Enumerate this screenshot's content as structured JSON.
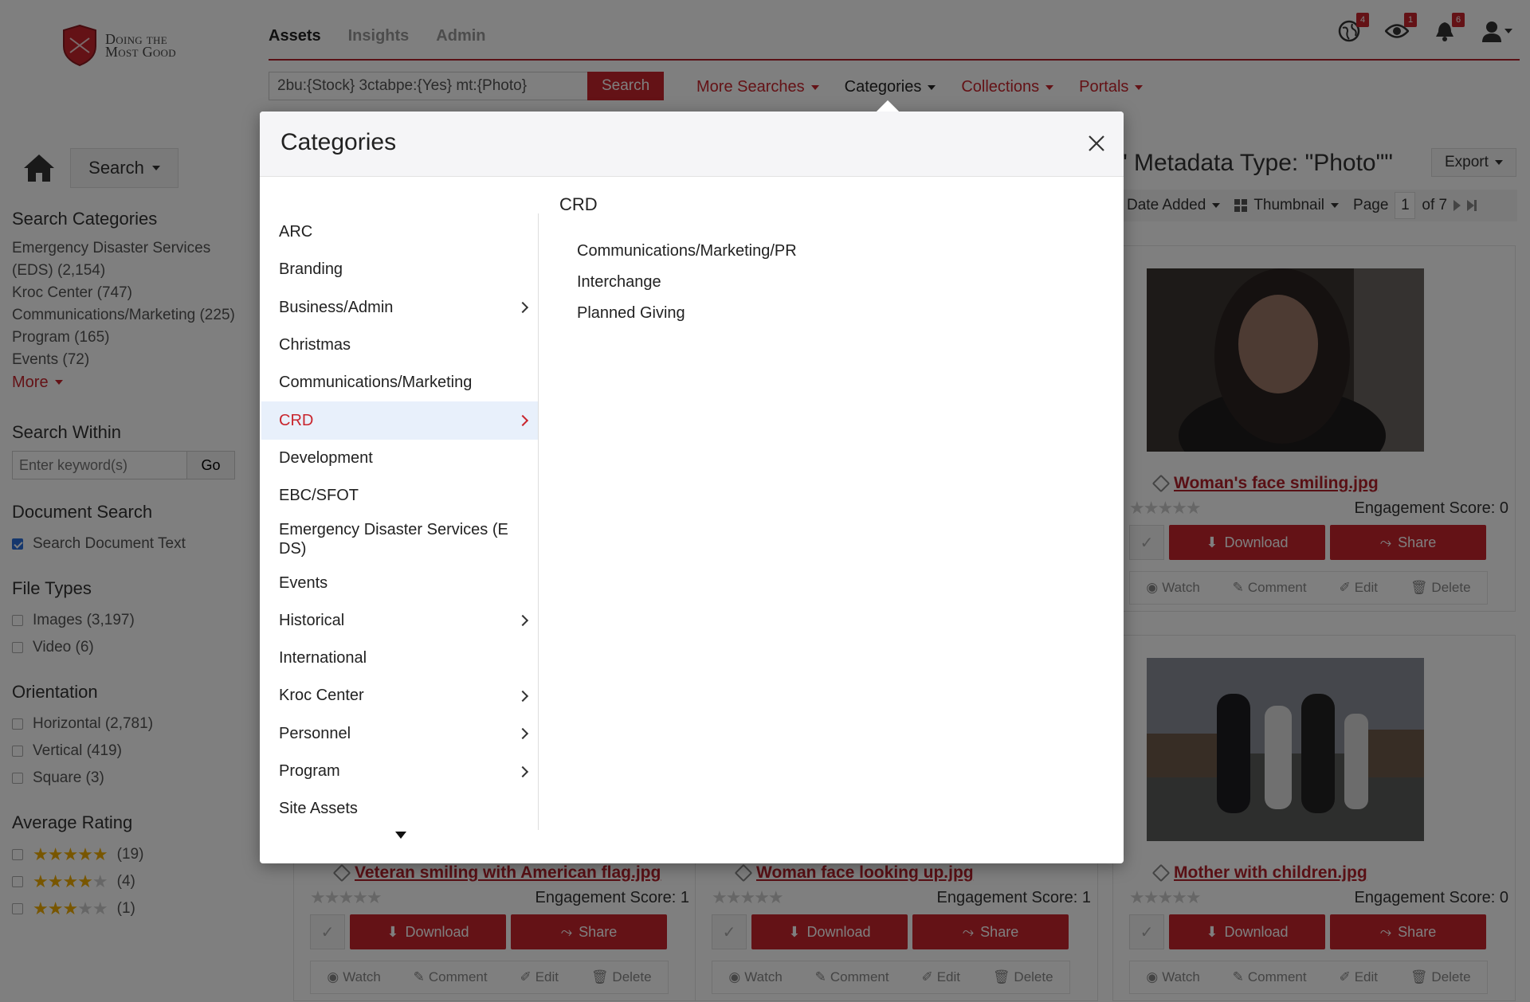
{
  "header": {
    "logo_text_line1": "Doing the",
    "logo_text_line2": "Most Good",
    "tabs": [
      {
        "label": "Assets",
        "active": true
      },
      {
        "label": "Insights",
        "active": false
      },
      {
        "label": "Admin",
        "active": false
      }
    ],
    "icons": [
      {
        "name": "globe-icon",
        "badge": "4"
      },
      {
        "name": "eye-icon",
        "badge": "1"
      },
      {
        "name": "bell-icon",
        "badge": "6"
      },
      {
        "name": "user-icon",
        "badge": ""
      }
    ]
  },
  "search": {
    "query": "2bu:{Stock} 3ctabpe:{Yes} mt:{Photo}",
    "button_label": "Search"
  },
  "nav": {
    "menus": [
      "More Searches",
      "Categories",
      "Collections",
      "Portals"
    ],
    "active_menu": "Categories"
  },
  "sidebar": {
    "search_button_label": "Search",
    "search_categories": {
      "heading": "Search Categories",
      "items": [
        "Emergency Disaster Services (EDS) (2,154)",
        "Kroc Center (747)",
        "Communications/Marketing (225)",
        "Program (165)",
        "Events (72)"
      ],
      "more_label": "More"
    },
    "search_within": {
      "heading": "Search Within",
      "placeholder": "Enter keyword(s)",
      "go_label": "Go"
    },
    "document_search": {
      "heading": "Document Search",
      "option": "Search Document Text",
      "checked": true
    },
    "file_types": {
      "heading": "File Types",
      "options": [
        "Images (3,197)",
        "Video (6)"
      ]
    },
    "orientation": {
      "heading": "Orientation",
      "options": [
        "Horizontal (2,781)",
        "Vertical (419)",
        "Square (3)"
      ]
    },
    "average_rating": {
      "heading": "Average Rating",
      "options": [
        {
          "stars": 5,
          "count": "(19)"
        },
        {
          "stars": 4,
          "count": "(4)"
        },
        {
          "stars": 3,
          "count": "(1)"
        }
      ]
    }
  },
  "results": {
    "title_fragment": "\" Metadata Type: \"Photo\"\"",
    "export_label": "Export",
    "sort_label": "Date Added",
    "view_label": "Thumbnail",
    "page_label": "Page",
    "page_value": "1",
    "page_total": "of 7",
    "cards": [
      {
        "title": "Woman's face smiling.jpg",
        "engagement": "Engagement Score: 0",
        "rating": 0
      },
      {
        "title": "Mother with children.jpg",
        "engagement": "Engagement Score: 0",
        "rating": 0
      },
      {
        "title": "Veteran smiling with American flag.jpg",
        "engagement": "Engagement Score: 1",
        "rating": 0
      },
      {
        "title": "Woman face looking up.jpg",
        "engagement": "Engagement Score: 1",
        "rating": 0
      }
    ],
    "download_label": "Download",
    "share_label": "Share",
    "link_labels": [
      "Watch",
      "Comment",
      "Edit",
      "Delete"
    ]
  },
  "modal": {
    "title": "Categories",
    "categories": [
      {
        "label": "ARC",
        "has_children": false
      },
      {
        "label": "Branding",
        "has_children": false
      },
      {
        "label": "Business/Admin",
        "has_children": true
      },
      {
        "label": "Christmas",
        "has_children": false
      },
      {
        "label": "Communications/Marketing",
        "has_children": false
      },
      {
        "label": "CRD",
        "has_children": true,
        "selected": true
      },
      {
        "label": "Development",
        "has_children": false
      },
      {
        "label": "EBC/SFOT",
        "has_children": false
      },
      {
        "label": "Emergency Disaster Services (E DS)",
        "has_children": false
      },
      {
        "label": "Events",
        "has_children": false
      },
      {
        "label": "Historical",
        "has_children": true
      },
      {
        "label": "International",
        "has_children": false
      },
      {
        "label": "Kroc Center",
        "has_children": true
      },
      {
        "label": "Personnel",
        "has_children": true
      },
      {
        "label": "Program",
        "has_children": true
      },
      {
        "label": "Site Assets",
        "has_children": false
      }
    ],
    "selected_title": "CRD",
    "subcategories": [
      "Communications/Marketing/PR",
      "Interchange",
      "Planned Giving"
    ]
  },
  "colors": {
    "brand_red": "#c9252d",
    "selected_bg": "#e8f0fb",
    "overlay": "rgba(0,0,0,0.5)"
  }
}
